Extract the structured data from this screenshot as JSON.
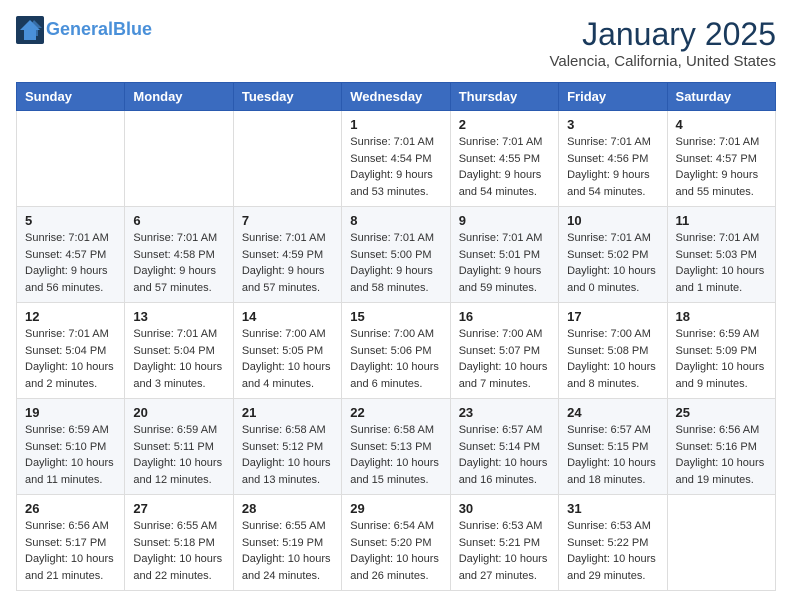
{
  "header": {
    "logo_line1": "General",
    "logo_line2": "Blue",
    "month_title": "January 2025",
    "location": "Valencia, California, United States"
  },
  "weekdays": [
    "Sunday",
    "Monday",
    "Tuesday",
    "Wednesday",
    "Thursday",
    "Friday",
    "Saturday"
  ],
  "weeks": [
    [
      {
        "day": "",
        "sunrise": "",
        "sunset": "",
        "daylight": ""
      },
      {
        "day": "",
        "sunrise": "",
        "sunset": "",
        "daylight": ""
      },
      {
        "day": "",
        "sunrise": "",
        "sunset": "",
        "daylight": ""
      },
      {
        "day": "1",
        "sunrise": "Sunrise: 7:01 AM",
        "sunset": "Sunset: 4:54 PM",
        "daylight": "Daylight: 9 hours and 53 minutes."
      },
      {
        "day": "2",
        "sunrise": "Sunrise: 7:01 AM",
        "sunset": "Sunset: 4:55 PM",
        "daylight": "Daylight: 9 hours and 54 minutes."
      },
      {
        "day": "3",
        "sunrise": "Sunrise: 7:01 AM",
        "sunset": "Sunset: 4:56 PM",
        "daylight": "Daylight: 9 hours and 54 minutes."
      },
      {
        "day": "4",
        "sunrise": "Sunrise: 7:01 AM",
        "sunset": "Sunset: 4:57 PM",
        "daylight": "Daylight: 9 hours and 55 minutes."
      }
    ],
    [
      {
        "day": "5",
        "sunrise": "Sunrise: 7:01 AM",
        "sunset": "Sunset: 4:57 PM",
        "daylight": "Daylight: 9 hours and 56 minutes."
      },
      {
        "day": "6",
        "sunrise": "Sunrise: 7:01 AM",
        "sunset": "Sunset: 4:58 PM",
        "daylight": "Daylight: 9 hours and 57 minutes."
      },
      {
        "day": "7",
        "sunrise": "Sunrise: 7:01 AM",
        "sunset": "Sunset: 4:59 PM",
        "daylight": "Daylight: 9 hours and 57 minutes."
      },
      {
        "day": "8",
        "sunrise": "Sunrise: 7:01 AM",
        "sunset": "Sunset: 5:00 PM",
        "daylight": "Daylight: 9 hours and 58 minutes."
      },
      {
        "day": "9",
        "sunrise": "Sunrise: 7:01 AM",
        "sunset": "Sunset: 5:01 PM",
        "daylight": "Daylight: 9 hours and 59 minutes."
      },
      {
        "day": "10",
        "sunrise": "Sunrise: 7:01 AM",
        "sunset": "Sunset: 5:02 PM",
        "daylight": "Daylight: 10 hours and 0 minutes."
      },
      {
        "day": "11",
        "sunrise": "Sunrise: 7:01 AM",
        "sunset": "Sunset: 5:03 PM",
        "daylight": "Daylight: 10 hours and 1 minute."
      }
    ],
    [
      {
        "day": "12",
        "sunrise": "Sunrise: 7:01 AM",
        "sunset": "Sunset: 5:04 PM",
        "daylight": "Daylight: 10 hours and 2 minutes."
      },
      {
        "day": "13",
        "sunrise": "Sunrise: 7:01 AM",
        "sunset": "Sunset: 5:04 PM",
        "daylight": "Daylight: 10 hours and 3 minutes."
      },
      {
        "day": "14",
        "sunrise": "Sunrise: 7:00 AM",
        "sunset": "Sunset: 5:05 PM",
        "daylight": "Daylight: 10 hours and 4 minutes."
      },
      {
        "day": "15",
        "sunrise": "Sunrise: 7:00 AM",
        "sunset": "Sunset: 5:06 PM",
        "daylight": "Daylight: 10 hours and 6 minutes."
      },
      {
        "day": "16",
        "sunrise": "Sunrise: 7:00 AM",
        "sunset": "Sunset: 5:07 PM",
        "daylight": "Daylight: 10 hours and 7 minutes."
      },
      {
        "day": "17",
        "sunrise": "Sunrise: 7:00 AM",
        "sunset": "Sunset: 5:08 PM",
        "daylight": "Daylight: 10 hours and 8 minutes."
      },
      {
        "day": "18",
        "sunrise": "Sunrise: 6:59 AM",
        "sunset": "Sunset: 5:09 PM",
        "daylight": "Daylight: 10 hours and 9 minutes."
      }
    ],
    [
      {
        "day": "19",
        "sunrise": "Sunrise: 6:59 AM",
        "sunset": "Sunset: 5:10 PM",
        "daylight": "Daylight: 10 hours and 11 minutes."
      },
      {
        "day": "20",
        "sunrise": "Sunrise: 6:59 AM",
        "sunset": "Sunset: 5:11 PM",
        "daylight": "Daylight: 10 hours and 12 minutes."
      },
      {
        "day": "21",
        "sunrise": "Sunrise: 6:58 AM",
        "sunset": "Sunset: 5:12 PM",
        "daylight": "Daylight: 10 hours and 13 minutes."
      },
      {
        "day": "22",
        "sunrise": "Sunrise: 6:58 AM",
        "sunset": "Sunset: 5:13 PM",
        "daylight": "Daylight: 10 hours and 15 minutes."
      },
      {
        "day": "23",
        "sunrise": "Sunrise: 6:57 AM",
        "sunset": "Sunset: 5:14 PM",
        "daylight": "Daylight: 10 hours and 16 minutes."
      },
      {
        "day": "24",
        "sunrise": "Sunrise: 6:57 AM",
        "sunset": "Sunset: 5:15 PM",
        "daylight": "Daylight: 10 hours and 18 minutes."
      },
      {
        "day": "25",
        "sunrise": "Sunrise: 6:56 AM",
        "sunset": "Sunset: 5:16 PM",
        "daylight": "Daylight: 10 hours and 19 minutes."
      }
    ],
    [
      {
        "day": "26",
        "sunrise": "Sunrise: 6:56 AM",
        "sunset": "Sunset: 5:17 PM",
        "daylight": "Daylight: 10 hours and 21 minutes."
      },
      {
        "day": "27",
        "sunrise": "Sunrise: 6:55 AM",
        "sunset": "Sunset: 5:18 PM",
        "daylight": "Daylight: 10 hours and 22 minutes."
      },
      {
        "day": "28",
        "sunrise": "Sunrise: 6:55 AM",
        "sunset": "Sunset: 5:19 PM",
        "daylight": "Daylight: 10 hours and 24 minutes."
      },
      {
        "day": "29",
        "sunrise": "Sunrise: 6:54 AM",
        "sunset": "Sunset: 5:20 PM",
        "daylight": "Daylight: 10 hours and 26 minutes."
      },
      {
        "day": "30",
        "sunrise": "Sunrise: 6:53 AM",
        "sunset": "Sunset: 5:21 PM",
        "daylight": "Daylight: 10 hours and 27 minutes."
      },
      {
        "day": "31",
        "sunrise": "Sunrise: 6:53 AM",
        "sunset": "Sunset: 5:22 PM",
        "daylight": "Daylight: 10 hours and 29 minutes."
      },
      {
        "day": "",
        "sunrise": "",
        "sunset": "",
        "daylight": ""
      }
    ]
  ]
}
